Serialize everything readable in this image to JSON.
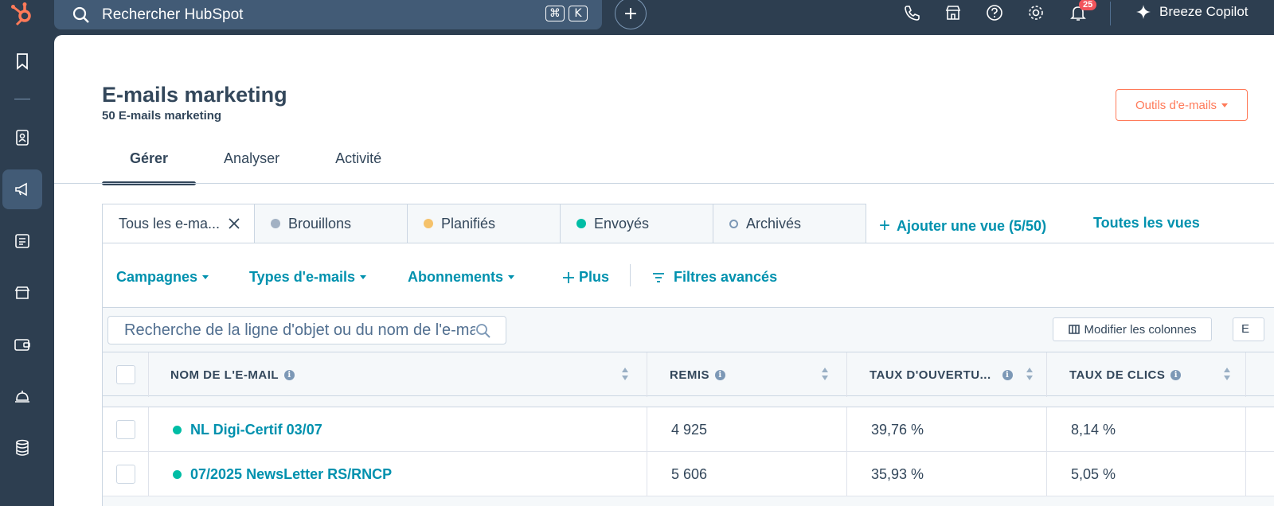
{
  "topbar": {
    "search_placeholder": "Rechercher HubSpot",
    "kbd_cmd": "⌘",
    "kbd_k": "K",
    "notification_count": "25",
    "copilot_label": "Breeze Copilot"
  },
  "page": {
    "title": "E-mails marketing",
    "subtitle": "50 E-mails marketing",
    "tools_button": "Outils d'e-mails"
  },
  "tabs": [
    {
      "label": "Gérer"
    },
    {
      "label": "Analyser"
    },
    {
      "label": "Activité"
    }
  ],
  "views": [
    {
      "label": "Tous les e-ma...",
      "color": ""
    },
    {
      "label": "Brouillons",
      "color": "#a2b1c3"
    },
    {
      "label": "Planifiés",
      "color": "#f5c26b"
    },
    {
      "label": "Envoyés",
      "color": "#00bda5"
    },
    {
      "label": "Archivés",
      "color": "hollow"
    }
  ],
  "add_view": "Ajouter une vue (5/50)",
  "all_views": "Toutes les vues",
  "filters": {
    "campaigns": "Campagnes",
    "email_types": "Types d'e-mails",
    "subscriptions": "Abonnements",
    "more": "Plus",
    "advanced": "Filtres avancés"
  },
  "table": {
    "search_placeholder": "Recherche de la ligne d'objet ou du nom de l'e-mail",
    "edit_columns": "Modifier les colonnes",
    "partial_button": "E",
    "columns": {
      "name": "NOM DE L'E-MAIL",
      "delivered": "REMIS",
      "open_rate": "TAUX D'OUVERTU...",
      "click_rate": "TAUX DE CLICS"
    },
    "rows": [
      {
        "name": "NL Digi-Certif 03/07",
        "delivered": "4 925",
        "open_rate": "39,76 %",
        "click_rate": "8,14 %"
      },
      {
        "name": "07/2025 NewsLetter RS/RNCP",
        "delivered": "5 606",
        "open_rate": "35,93 %",
        "click_rate": "5,05 %"
      }
    ]
  },
  "colors": {
    "brand": "#ff7a59",
    "link": "#0091ae",
    "nav_bg": "#2d3e50",
    "sent": "#00bda5"
  }
}
